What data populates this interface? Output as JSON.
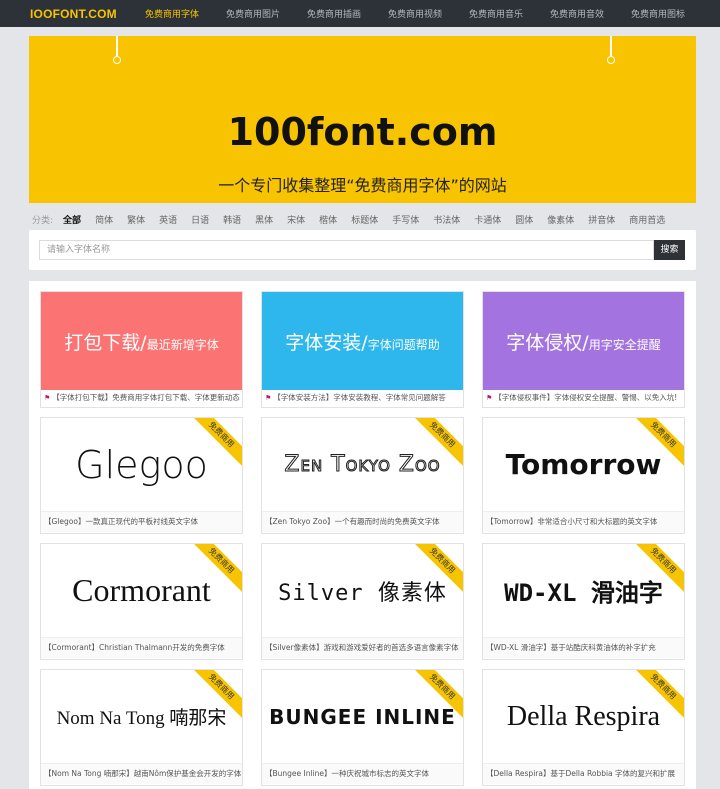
{
  "nav": {
    "logo": "IOOFONT.COM",
    "links": [
      "免费商用字体",
      "免费商用图片",
      "免费商用插画",
      "免费商用视频",
      "免费商用音乐",
      "免费商用音效",
      "免费商用图标"
    ]
  },
  "banner": {
    "title": "100font.com",
    "subtitle": "一个专门收集整理“免费商用字体”的网站"
  },
  "categories": {
    "label": "分类:",
    "items": [
      "全部",
      "简体",
      "繁体",
      "英语",
      "日语",
      "韩语",
      "黑体",
      "宋体",
      "楷体",
      "标题体",
      "手写体",
      "书法体",
      "卡通体",
      "圆体",
      "像素体",
      "拼音体",
      "商用首选"
    ]
  },
  "search": {
    "placeholder": "请输入字体名称",
    "button": "搜索"
  },
  "ribbon": "免费商用",
  "featured": [
    {
      "main": "打包下载",
      "sub": "最近新增字体",
      "caption": "【字体打包下载】免费商用字体打包下载、字体更新动态",
      "color": "#fb7373"
    },
    {
      "main": "字体安装",
      "sub": "字体问题帮助",
      "caption": "【字体安装方法】字体安装教程、字体常见问题解答",
      "color": "#2db7ec"
    },
    {
      "main": "字体侵权",
      "sub": "用字安全提醒",
      "caption": "【字体侵权事件】字体侵权安全提醒、警惕、以免入坑!",
      "color": "#a374e0"
    }
  ],
  "fonts": [
    {
      "sample": "Glegoo",
      "caption": "【Glegoo】一款真正现代的平板衬线英文字体"
    },
    {
      "sample": "Zen Tokyo Zoo",
      "caption": "【Zen Tokyo Zoo】一个有趣而时尚的免费英文字体"
    },
    {
      "sample": "Tomorrow",
      "caption": "【Tomorrow】非常适合小尺寸和大标题的英文字体"
    },
    {
      "sample": "Cormorant",
      "caption": "【Cormorant】Christian Thalmann开发的免费字体"
    },
    {
      "sample": "Silver 像素体",
      "caption": "【Silver像素体】游戏和游戏爱好者的首选多语言像素字体"
    },
    {
      "sample": "WD-XL 滑油字",
      "caption": "【WD-XL 滑油字】基于站酷庆科黄油体的补字扩充"
    },
    {
      "sample": "Nom Na Tong 喃那宋",
      "caption": "【Nom Na Tong 喃那宋】越南Nôm保护基金会开发的字体"
    },
    {
      "sample": "BUNGEE INLINE",
      "caption": "【Bungee Inline】一种庆祝城市标志的英文字体"
    },
    {
      "sample": "Della Respira",
      "caption": "【Della Respira】基于Della Robbia 字体的复兴和扩展"
    }
  ]
}
